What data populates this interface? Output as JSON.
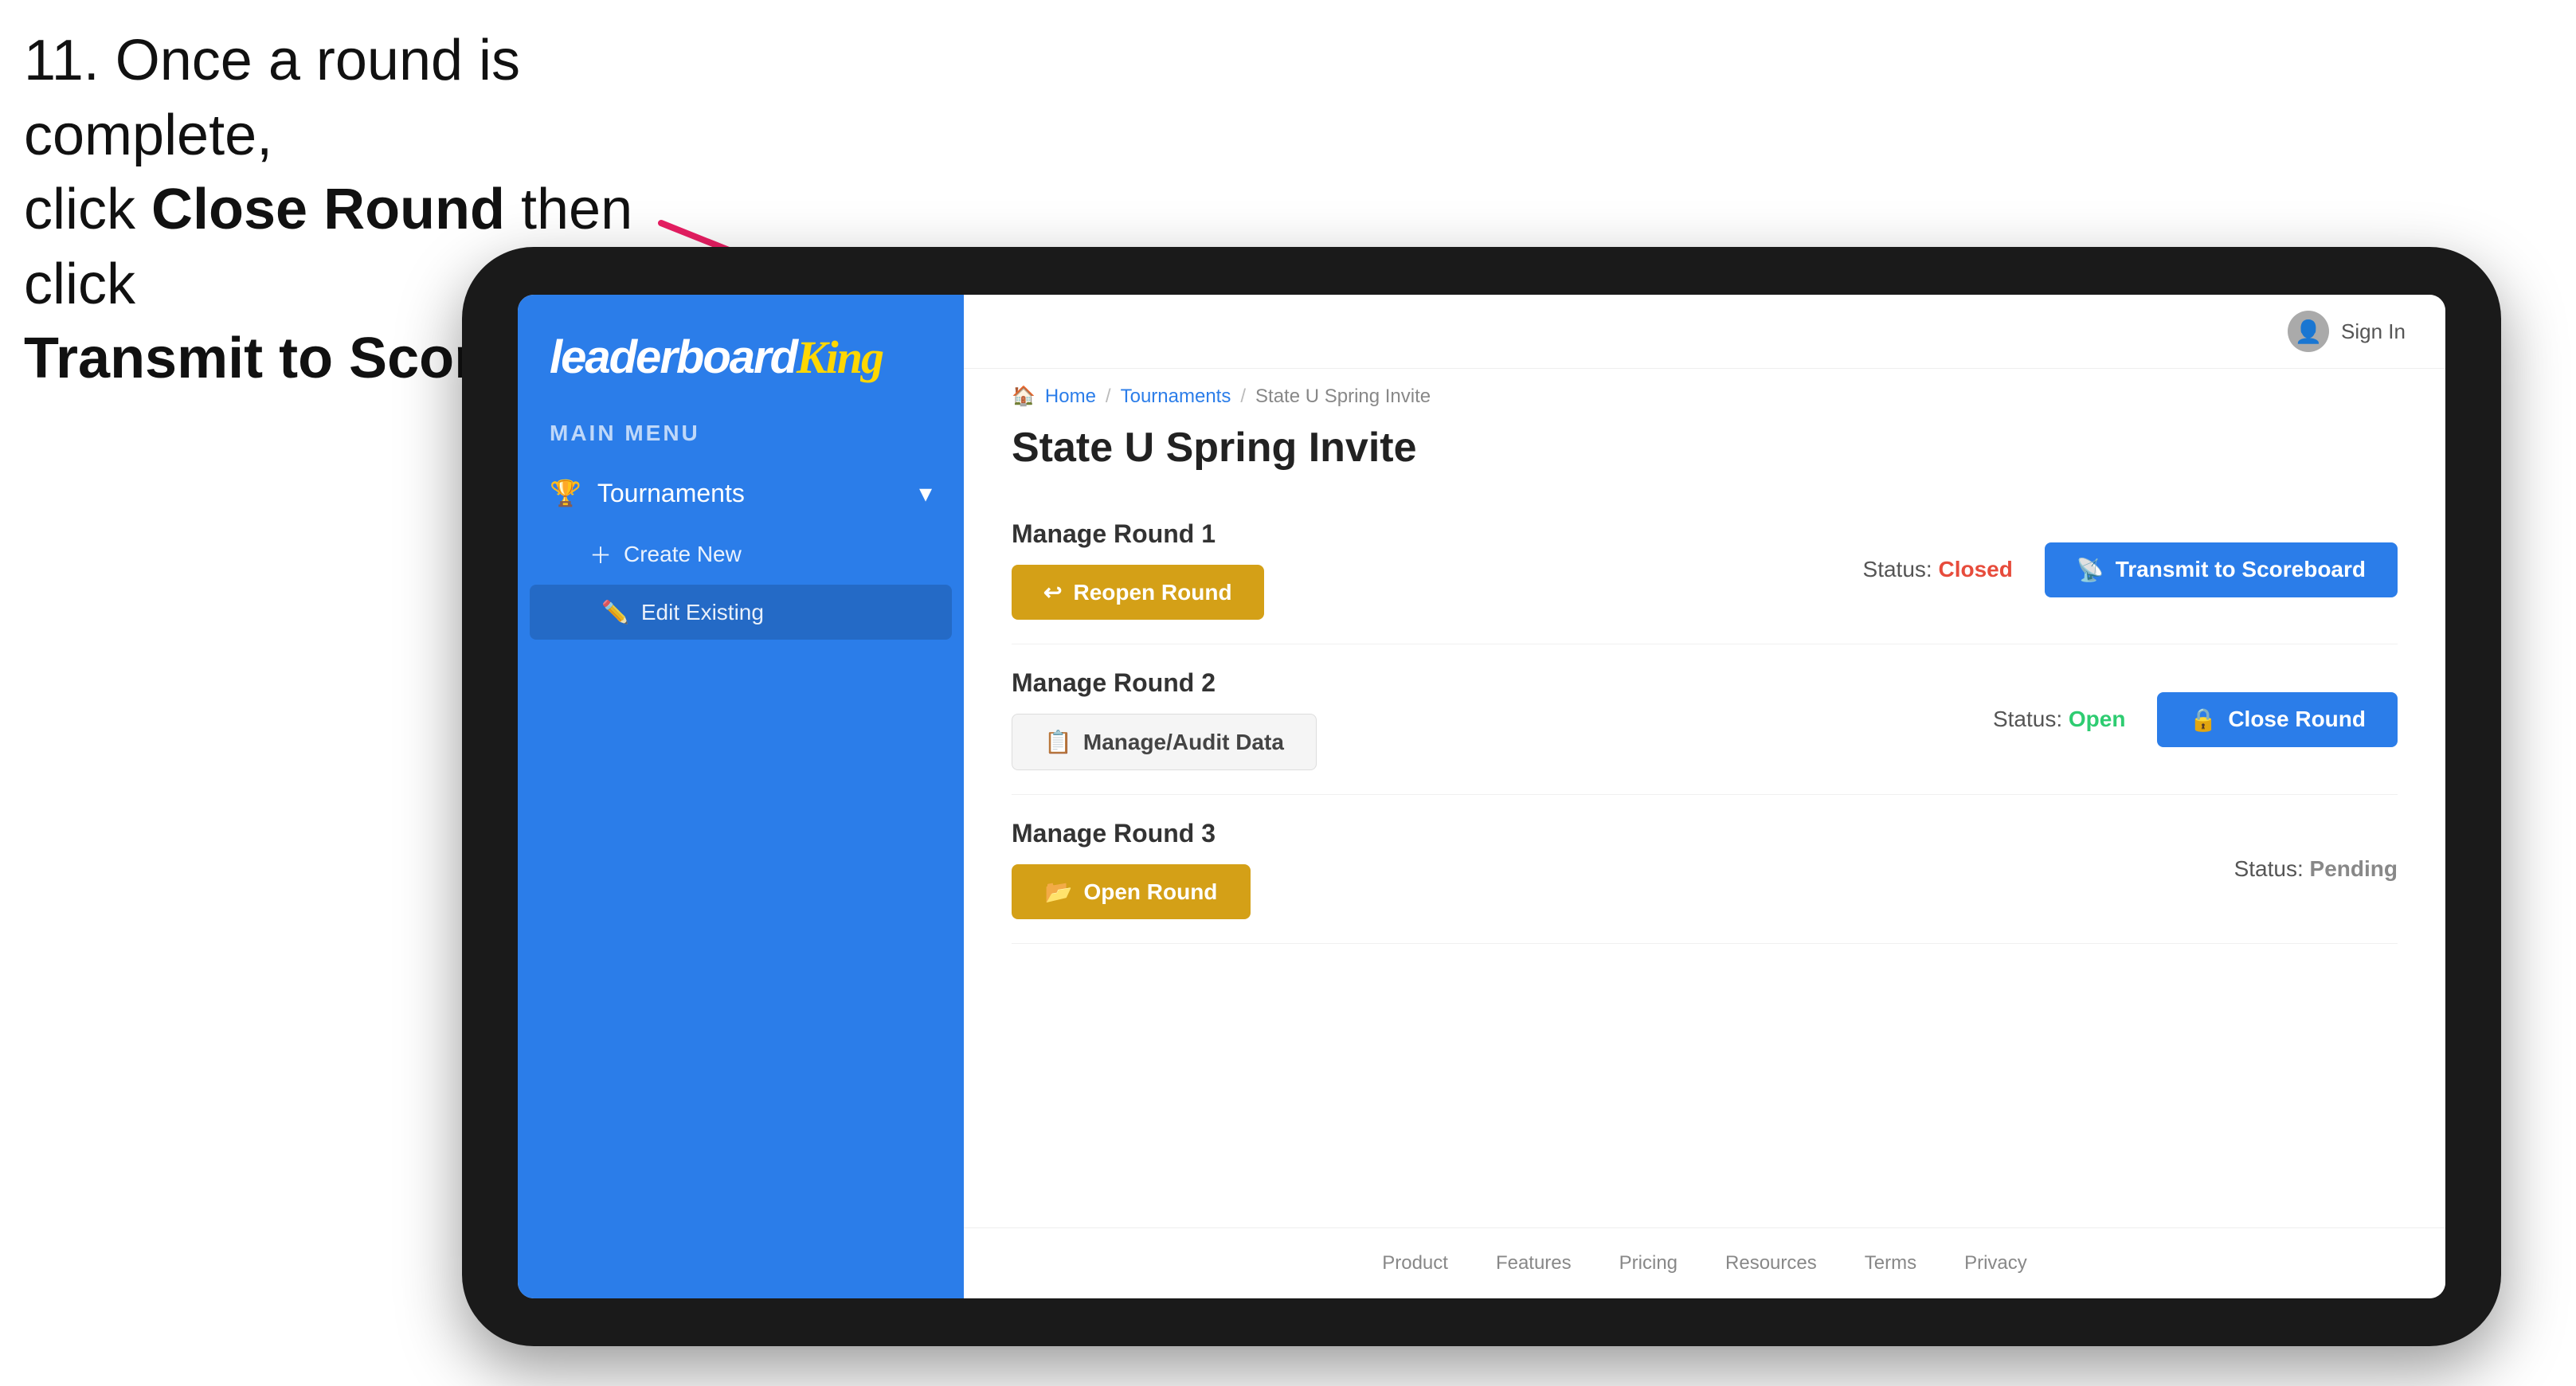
{
  "instruction": {
    "line1": "11. Once a round is complete,",
    "line2": "click ",
    "bold1": "Close Round",
    "line3": " then click",
    "bold2": "Transmit to Scoreboard."
  },
  "app": {
    "logo": {
      "leaderboard": "leaderboard",
      "king": "King"
    },
    "sidebar": {
      "main_menu_label": "MAIN MENU",
      "tournaments_label": "Tournaments",
      "create_new_label": "Create New",
      "edit_existing_label": "Edit Existing"
    },
    "header": {
      "sign_in": "Sign In",
      "avatar_char": "👤"
    },
    "breadcrumb": {
      "home": "Home",
      "tournaments": "Tournaments",
      "current": "State U Spring Invite"
    },
    "page_title": "State U Spring Invite",
    "rounds": [
      {
        "id": "round1",
        "title": "Manage Round 1",
        "status_label": "Status:",
        "status_value": "Closed",
        "status_type": "closed",
        "primary_button": "Reopen Round",
        "primary_btn_type": "gold",
        "secondary_button": "Transmit to Scoreboard",
        "secondary_btn_type": "blue"
      },
      {
        "id": "round2",
        "title": "Manage Round 2",
        "status_label": "Status:",
        "status_value": "Open",
        "status_type": "open",
        "primary_button": "Manage/Audit Data",
        "primary_btn_type": "manage",
        "secondary_button": "Close Round",
        "secondary_btn_type": "blue"
      },
      {
        "id": "round3",
        "title": "Manage Round 3",
        "status_label": "Status:",
        "status_value": "Pending",
        "status_type": "pending",
        "primary_button": "Open Round",
        "primary_btn_type": "gold",
        "secondary_button": null,
        "secondary_btn_type": null
      }
    ],
    "footer": {
      "links": [
        "Product",
        "Features",
        "Pricing",
        "Resources",
        "Terms",
        "Privacy"
      ]
    }
  }
}
